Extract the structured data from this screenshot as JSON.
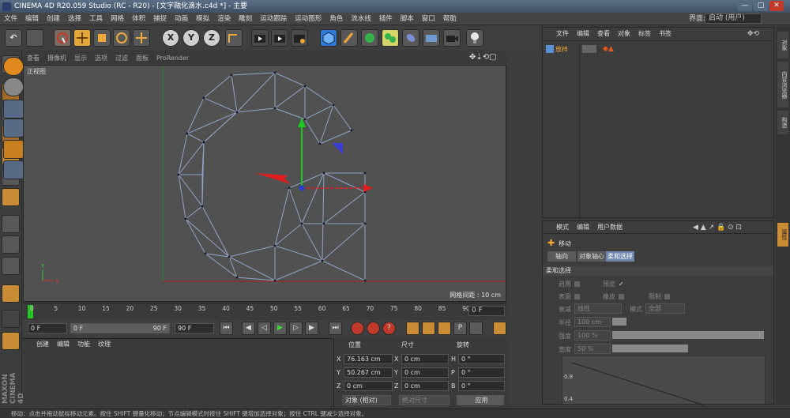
{
  "window": {
    "title": "CINEMA 4D R20.059 Studio (RC - R20) - [文字融化滴水.c4d *] - 主要",
    "min": "—",
    "max": "▢",
    "close": "✕"
  },
  "menu": [
    "文件",
    "编辑",
    "创建",
    "选择",
    "工具",
    "网格",
    "体积",
    "捕捉",
    "动画",
    "模拟",
    "渲染",
    "雕刻",
    "运动跟踪",
    "运动图形",
    "角色",
    "流水线",
    "插件",
    "脚本",
    "窗口",
    "帮助"
  ],
  "layout": {
    "label": "界面:",
    "value": "启动 (用户)"
  },
  "toolbar": {
    "undo": "↶",
    "x": "X",
    "y": "Y",
    "z": "Z"
  },
  "viewport": {
    "menu": [
      "查看",
      "摄像机",
      "显示",
      "选项",
      "过滤",
      "面板",
      "ProRender"
    ],
    "label": "正视图",
    "grid_text": "网格间距 : 10 cm",
    "axis_x": "X",
    "axis_y": "Y"
  },
  "timeline": {
    "ticks": [
      "0",
      "5",
      "10",
      "15",
      "20",
      "25",
      "30",
      "35",
      "40",
      "45",
      "50",
      "55",
      "60",
      "65",
      "70",
      "75",
      "80",
      "85",
      "90"
    ],
    "current_frame": "0 F",
    "start": "0 F",
    "min": "0 F",
    "max": "90 F",
    "end": "90 F"
  },
  "materials": {
    "menu": [
      "创建",
      "编辑",
      "功能",
      "纹理"
    ]
  },
  "coords": {
    "headers": [
      "位置",
      "尺寸",
      "旋转"
    ],
    "rows": [
      {
        "axis": "X",
        "pos": "76.163 cm",
        "size": "0 cm",
        "rot_label": "H",
        "rot": "0 °"
      },
      {
        "axis": "Y",
        "pos": "50.267 cm",
        "size": "0 cm",
        "rot_label": "P",
        "rot": "0 °"
      },
      {
        "axis": "Z",
        "pos": "0 cm",
        "size": "0 cm",
        "rot_label": "B",
        "rot": "0 °"
      }
    ],
    "mode": "对象 (相对)",
    "size_mode": "绝对尺寸",
    "apply": "应用"
  },
  "objects": {
    "menu": [
      "文件",
      "编辑",
      "查看",
      "对象",
      "标签",
      "书签"
    ],
    "items": [
      {
        "name": "放样"
      }
    ]
  },
  "attributes": {
    "menu": [
      "模式",
      "编辑",
      "用户数据"
    ],
    "tool": "移动",
    "tabs": [
      "轴向",
      "对象轴心",
      "柔和选择"
    ],
    "section": "柔和选择",
    "rows": {
      "enable": "启用",
      "preview": "预览",
      "surface": "表面",
      "rubber": "橡皮",
      "limit": "限制",
      "falloff": "衰减",
      "falloff_val": "线性",
      "mode": "模式",
      "mode_val": "全部",
      "radius": "半径",
      "radius_val": "100 cm",
      "strength": "强度",
      "strength_val": "100 %",
      "width": "宽度",
      "width_val": "50 %"
    },
    "graph_ticks": [
      "0.8",
      "0.4"
    ]
  },
  "sidetabs": [
    "对象",
    "内容浏览器",
    "构造"
  ],
  "sidetab_attr": "属性",
  "status": "移动：点击并拖动鼠标移动元素。按住 SHIFT 键量化移动；节点编辑模式时按住 SHIFT 键增加选择对象；按住 CTRL 键减少选择对象。",
  "colors": {
    "accent": "#f2a93b",
    "blue": "#3a7fd0",
    "wire": "#8fa6c8",
    "axis_x": "#c81e1e",
    "axis_y": "#1e9e1e"
  }
}
